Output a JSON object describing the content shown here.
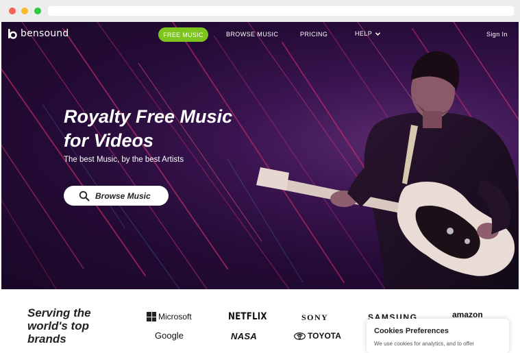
{
  "site": {
    "logo_text": "bensound"
  },
  "nav": {
    "free_music": "FREE MUSIC",
    "browse_music": "BROWSE MUSIC",
    "pricing": "PRICING",
    "help": "HELP",
    "sign_in": "Sign In"
  },
  "hero": {
    "title_line1": "Royalty Free Music",
    "title_line2": "for Videos",
    "subtitle": "The best Music, by the best Artists",
    "browse_button": "Browse Music"
  },
  "brands": {
    "heading_line1": "Serving the",
    "heading_line2": "world's top",
    "heading_line3": "brands",
    "logos": [
      "Microsoft",
      "NETFLIX",
      "SONY",
      "SAMSUNG",
      "amazon",
      "Google",
      "NASA",
      "TOYOTA"
    ]
  },
  "cookies": {
    "title": "Cookies Preferences",
    "text": "We use cookies for analytics, and to offer"
  },
  "colors": {
    "accent_green": "#7dc41e",
    "hero_purple": "#3a1450",
    "streak_pink": "#e0306e"
  }
}
